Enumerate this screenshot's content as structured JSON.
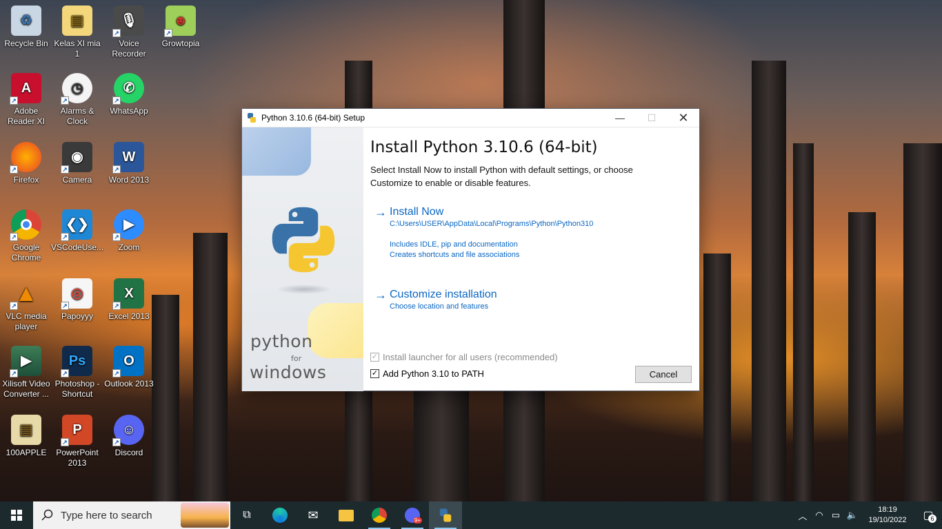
{
  "desktop": {
    "icons": [
      {
        "label": "Recycle Bin"
      },
      {
        "label": "Kelas XI mia 1"
      },
      {
        "label": "Voice Recorder"
      },
      {
        "label": "Growtopia"
      },
      {
        "label": "Adobe Reader XI"
      },
      {
        "label": "Alarms & Clock"
      },
      {
        "label": "WhatsApp"
      },
      {
        "label": "Firefox"
      },
      {
        "label": "Camera"
      },
      {
        "label": "Word 2013"
      },
      {
        "label": "Google Chrome"
      },
      {
        "label": "VSCodeUse..."
      },
      {
        "label": "Zoom"
      },
      {
        "label": "VLC media player"
      },
      {
        "label": "Papoyyy"
      },
      {
        "label": "Excel 2013"
      },
      {
        "label": "Xilisoft Video Converter ..."
      },
      {
        "label": "Photoshop - Shortcut"
      },
      {
        "label": "Outlook 2013"
      },
      {
        "label": "100APPLE"
      },
      {
        "label": "PowerPoint 2013"
      },
      {
        "label": "Discord"
      }
    ]
  },
  "dialog": {
    "title": "Python 3.10.6 (64-bit) Setup",
    "heading": "Install Python 3.10.6 (64-bit)",
    "description": "Select Install Now to install Python with default settings, or choose Customize to enable or disable features.",
    "install_now": {
      "label": "Install Now",
      "path": "C:\\Users\\USER\\AppData\\Local\\Programs\\Python\\Python310",
      "note1": "Includes IDLE, pip and documentation",
      "note2": "Creates shortcuts and file associations"
    },
    "customize": {
      "label": "Customize installation",
      "sub": "Choose location and features"
    },
    "checkbox_launcher": {
      "label": "Install launcher for all users (recommended)",
      "checked": true,
      "disabled": true
    },
    "checkbox_path": {
      "label": "Add Python 3.10 to PATH",
      "checked": true
    },
    "cancel_label": "Cancel",
    "brand_python": "python",
    "brand_for": "for",
    "brand_windows": "windows"
  },
  "taskbar": {
    "search_placeholder": "Type here to search",
    "discord_badge": "9+",
    "time": "18:19",
    "date": "19/10/2022",
    "notification_count": "6"
  },
  "colors": {
    "accent": "#0a66c2",
    "taskbar": "#1c2a2e"
  }
}
